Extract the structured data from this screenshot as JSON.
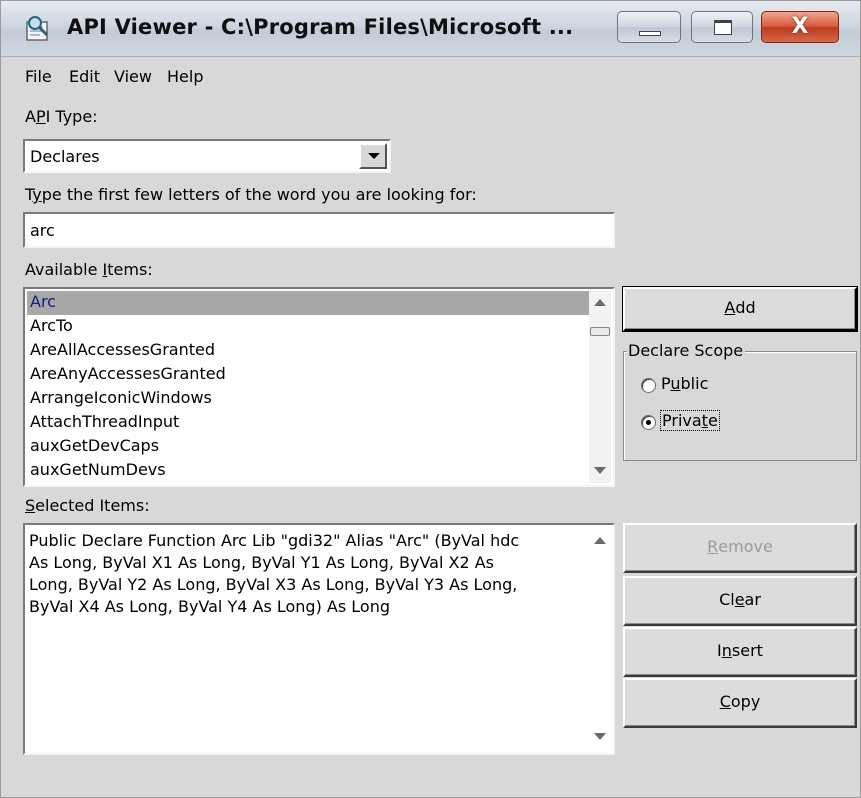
{
  "window": {
    "title": "API Viewer - C:\\Program Files\\Microsoft ...",
    "close_glyph": "X"
  },
  "menu": {
    "file": "File",
    "edit": "Edit",
    "view": "View",
    "help": "Help"
  },
  "api_type": {
    "label_pre": "A",
    "label_ul": "P",
    "label_post": "I Type:",
    "value": "Declares"
  },
  "search": {
    "label_pre": "T",
    "label_ul": "y",
    "label_post": "pe the first few letters of the word you are looking for:",
    "value": "arc"
  },
  "available": {
    "label_pre": "Available ",
    "label_ul": "I",
    "label_post": "tems:",
    "items": [
      "Arc",
      "ArcTo",
      "AreAllAccessesGranted",
      "AreAnyAccessesGranted",
      "ArrangeIconicWindows",
      "AttachThreadInput",
      "auxGetDevCaps",
      "auxGetNumDevs"
    ],
    "selected_index": 0
  },
  "buttons": {
    "add_ul": "A",
    "add_post": "dd",
    "remove_ul": "R",
    "remove_post": "emove",
    "clear_pre": "Cl",
    "clear_ul": "e",
    "clear_post": "ar",
    "insert_pre": "I",
    "insert_ul": "n",
    "insert_post": "sert",
    "copy_ul": "C",
    "copy_post": "opy"
  },
  "declare_scope": {
    "legend": "Declare Scope",
    "public_pre": "P",
    "public_ul": "u",
    "public_post": "blic",
    "private_pre": "Priva",
    "private_ul": "t",
    "private_post": "e",
    "selected": "private"
  },
  "selected_items": {
    "label_ul": "S",
    "label_post": "elected Items:",
    "text": "Public Declare Function Arc Lib \"gdi32\" Alias \"Arc\" (ByVal hdc\nAs Long, ByVal X1 As Long, ByVal Y1 As Long, ByVal X2 As\nLong, ByVal Y2 As Long, ByVal X3 As Long, ByVal Y3 As Long,\nByVal X4 As Long, ByVal Y4 As Long) As Long"
  },
  "colors": {
    "selection_bg": "#a8a8a8",
    "selection_text": "#15207a",
    "close_button": "#c0391c",
    "disabled_text": "#9a9a9a"
  },
  "icons": {
    "app": "magnifier-document-icon",
    "minimize": "minimize-icon",
    "maximize": "maximize-icon",
    "close": "close-icon"
  }
}
